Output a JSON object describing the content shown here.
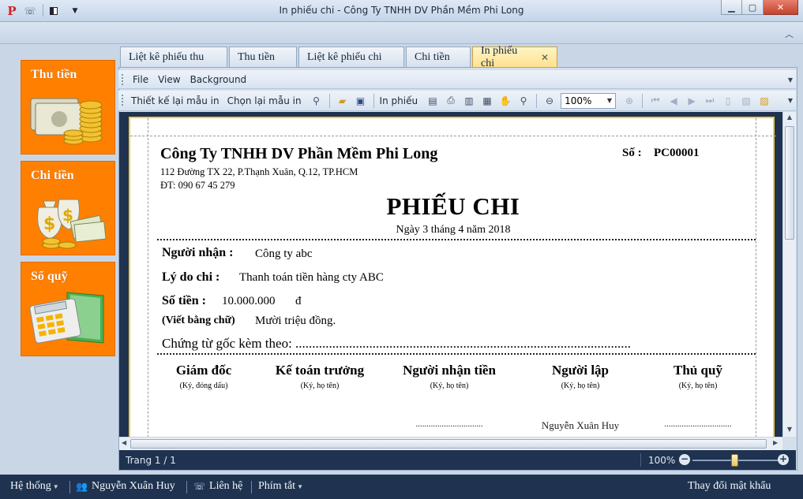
{
  "window": {
    "title": "In phiếu chi - Công Ty TNHH DV Phần Mềm Phi Long"
  },
  "tiles": [
    {
      "label": "Thu tiền",
      "icon": "cash-coins-icon"
    },
    {
      "label": "Chi tiền",
      "icon": "money-bags-icon"
    },
    {
      "label": "Sổ quỹ",
      "icon": "calculator-book-icon"
    }
  ],
  "tabs": [
    {
      "label": "Liệt kê phiếu thu",
      "active": false
    },
    {
      "label": "Thu tiền",
      "active": false
    },
    {
      "label": "Liệt kê phiếu chi",
      "active": false
    },
    {
      "label": "Chi tiền",
      "active": false
    },
    {
      "label": "In phiếu chi",
      "active": true
    }
  ],
  "menu": {
    "file": "File",
    "view": "View",
    "background": "Background"
  },
  "toolbar": {
    "design": "Thiết kế lại mẫu in",
    "choose": "Chọn lại mẫu in",
    "print": "In phiếu",
    "zoom": "100%"
  },
  "voucher": {
    "company": "Công Ty TNHH DV Phần Mềm Phi Long",
    "address": "112 Đường TX 22, P.Thạnh Xuân, Q.12, TP.HCM",
    "phone": "ĐT: 090 67 45 279",
    "number_label": "Số :",
    "number": "PC00001",
    "title": "PHIẾU CHI",
    "date": "Ngày 3 tháng 4 năm 2018",
    "receiver_label": "Người nhận :",
    "receiver": "Công ty abc",
    "reason_label": "Lý do chi :",
    "reason": "Thanh toán tiền hàng cty ABC",
    "amount_label": "Số tiền :",
    "amount": "10.000.000",
    "currency": "đ",
    "words_label": "(Viết bằng chữ)",
    "words": "Mười triệu đồng.",
    "attached": "Chứng từ gốc kèm theo: ...................................................................................................."
  },
  "signatures": [
    {
      "role": "Giám đốc",
      "note": "(Ký, đóng dấu)",
      "name": ""
    },
    {
      "role": "Kế toán trưởng",
      "note": "(Ký, họ tên)",
      "name": ""
    },
    {
      "role": "Người nhận tiền",
      "note": "(Ký, họ tên)",
      "name": "..............................."
    },
    {
      "role": "Người lập",
      "note": "(Ký, họ tên)",
      "name": "Nguyễn Xuân Huy"
    },
    {
      "role": "Thủ quỹ",
      "note": "(Ký, họ tên)",
      "name": "..............................."
    }
  ],
  "preview_status": {
    "page": "Trang 1 / 1",
    "zoom": "100%",
    "zoom_level": 0.5
  },
  "status": {
    "system": "Hệ thống",
    "user": "Nguyễn Xuân Huy",
    "contact": "Liên hệ",
    "shortcuts": "Phím tắt",
    "change_password": "Thay đổi mật khẩu"
  }
}
